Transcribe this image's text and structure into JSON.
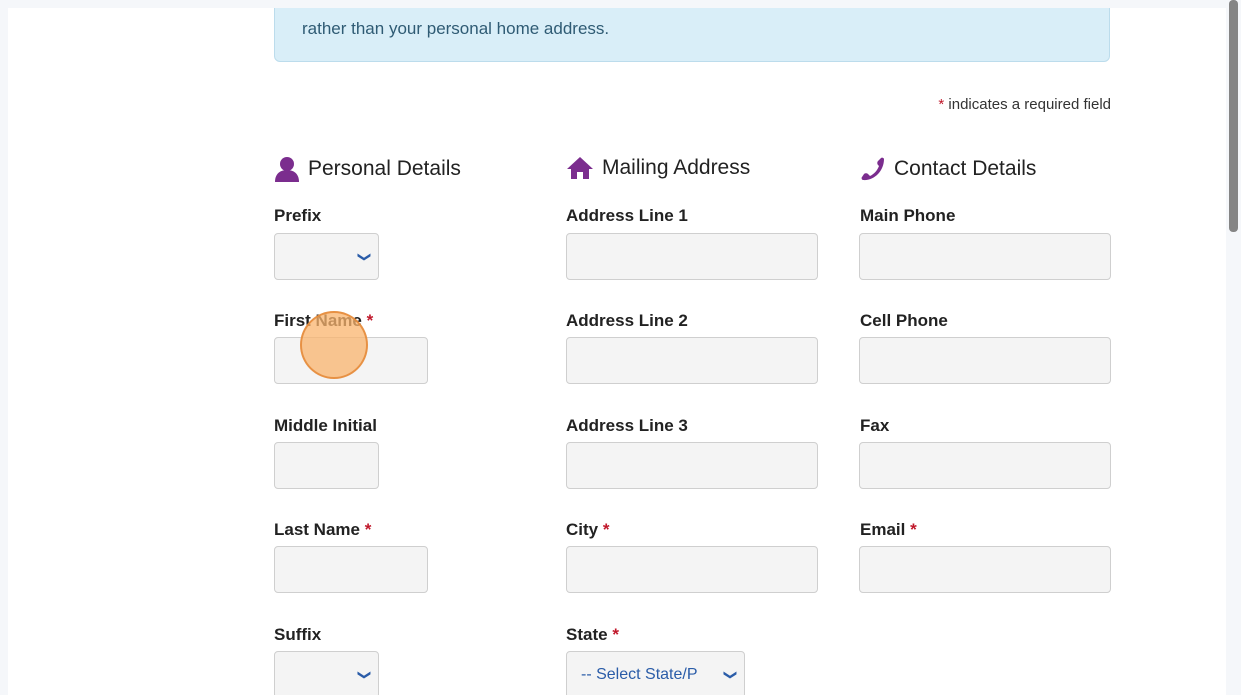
{
  "notice": {
    "text": "rather than your personal home address."
  },
  "required_note": {
    "star": "*",
    "text": "indicates a required field"
  },
  "sections": {
    "personal": {
      "title": "Personal Details",
      "icon": "person-icon"
    },
    "mailing": {
      "title": "Mailing Address",
      "icon": "home-icon"
    },
    "contact": {
      "title": "Contact Details",
      "icon": "phone-icon"
    }
  },
  "personal": {
    "prefix": {
      "label": "Prefix",
      "value": ""
    },
    "first_name": {
      "label": "First Name",
      "value": ""
    },
    "middle_initial": {
      "label": "Middle Initial",
      "value": ""
    },
    "last_name": {
      "label": "Last Name",
      "value": ""
    },
    "suffix": {
      "label": "Suffix",
      "value": ""
    }
  },
  "mailing": {
    "address1": {
      "label": "Address Line 1",
      "value": ""
    },
    "address2": {
      "label": "Address Line 2",
      "value": ""
    },
    "address3": {
      "label": "Address Line 3",
      "value": ""
    },
    "city": {
      "label": "City",
      "value": ""
    },
    "state": {
      "label": "State",
      "value": "-- Select State/P"
    }
  },
  "contact": {
    "main_phone": {
      "label": "Main Phone",
      "value": ""
    },
    "cell_phone": {
      "label": "Cell Phone",
      "value": ""
    },
    "fax": {
      "label": "Fax",
      "value": ""
    },
    "email": {
      "label": "Email",
      "value": ""
    }
  },
  "required_star": "*",
  "colors": {
    "accent_purple": "#7b2d8e",
    "required_red": "#c0172a",
    "notice_bg": "#d9eef8"
  }
}
